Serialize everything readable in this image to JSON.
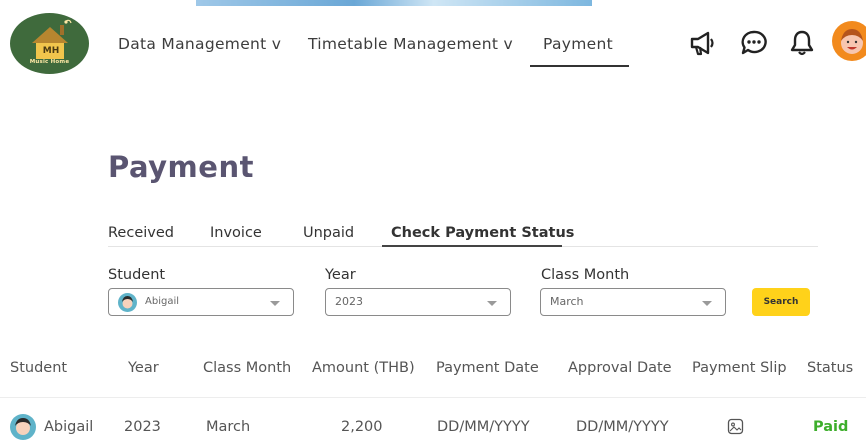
{
  "brand": {
    "logo_text": "MH",
    "logo_subtext": "Music Home"
  },
  "nav": {
    "items": [
      {
        "label": "Data Management v"
      },
      {
        "label": "Timetable Management v"
      },
      {
        "label": "Payment"
      }
    ],
    "icons": [
      "megaphone-icon",
      "chat-icon",
      "bell-icon"
    ]
  },
  "page": {
    "title": "Payment"
  },
  "tabs": [
    {
      "label": "Received"
    },
    {
      "label": "Invoice"
    },
    {
      "label": "Unpaid"
    },
    {
      "label": "Check Payment Status"
    }
  ],
  "filters": {
    "student": {
      "label": "Student",
      "value": "Abigail"
    },
    "year": {
      "label": "Year",
      "value": "2023"
    },
    "class_month": {
      "label": "Class Month",
      "value": "March"
    },
    "search_label": "Search"
  },
  "table": {
    "headers": [
      "Student",
      "Year",
      "Class Month",
      "Amount (THB)",
      "Payment Date",
      "Approval Date",
      "Payment Slip",
      "Status"
    ],
    "rows": [
      {
        "student": "Abigail",
        "year": "2023",
        "class_month": "March",
        "amount": "2,200",
        "payment_date": "DD/MM/YYYY",
        "approval_date": "DD/MM/YYYY",
        "status": "Paid"
      }
    ]
  },
  "colors": {
    "accent": "#ffd21a",
    "title": "#5a5571",
    "paid": "#3dae2b"
  }
}
